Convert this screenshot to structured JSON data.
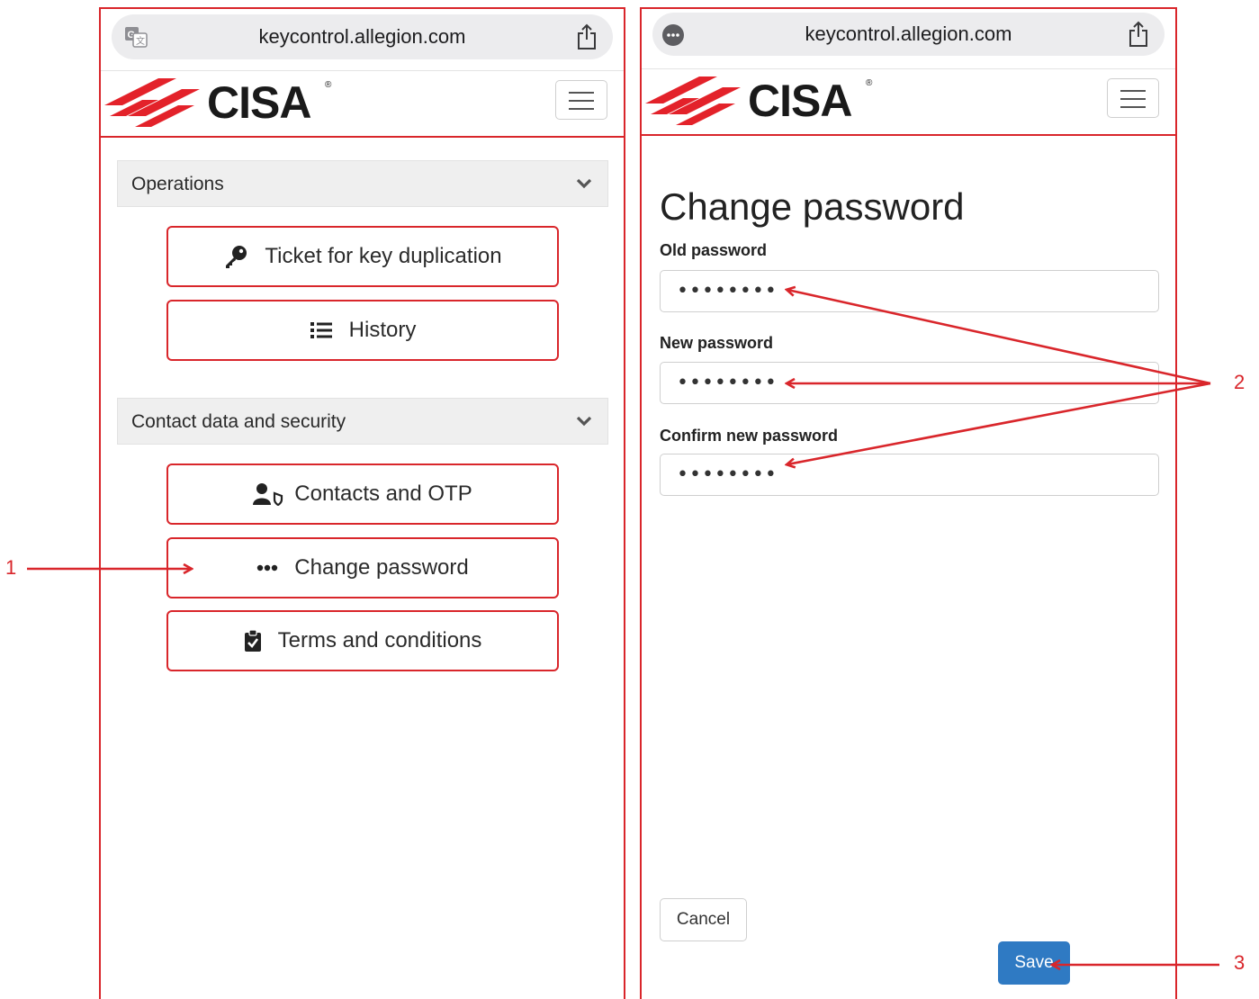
{
  "left_screen": {
    "url": "keycontrol.allegion.com",
    "brand": "CISA",
    "sections": [
      {
        "title": "Operations",
        "items": [
          {
            "label": "Ticket for key duplication",
            "icon": "key-icon"
          },
          {
            "label": "History",
            "icon": "list-icon"
          }
        ]
      },
      {
        "title": "Contact data and security",
        "items": [
          {
            "label": "Contacts and OTP",
            "icon": "user-shield-icon"
          },
          {
            "label": "Change password",
            "icon": "ellipsis-icon"
          },
          {
            "label": "Terms and conditions",
            "icon": "clipboard-check-icon"
          }
        ]
      }
    ]
  },
  "right_screen": {
    "url": "keycontrol.allegion.com",
    "brand": "CISA",
    "page_title": "Change password",
    "fields": [
      {
        "label": "Old password",
        "value": "••••••••"
      },
      {
        "label": "New password",
        "value": "••••••••"
      },
      {
        "label": "Confirm new password",
        "value": "••••••••"
      }
    ],
    "cancel_label": "Cancel",
    "save_label": "Save"
  },
  "callouts": [
    "1",
    "2",
    "3"
  ],
  "colors": {
    "accent_red": "#d9262b",
    "save_blue": "#2f7ac3",
    "section_gray": "#efefef"
  }
}
